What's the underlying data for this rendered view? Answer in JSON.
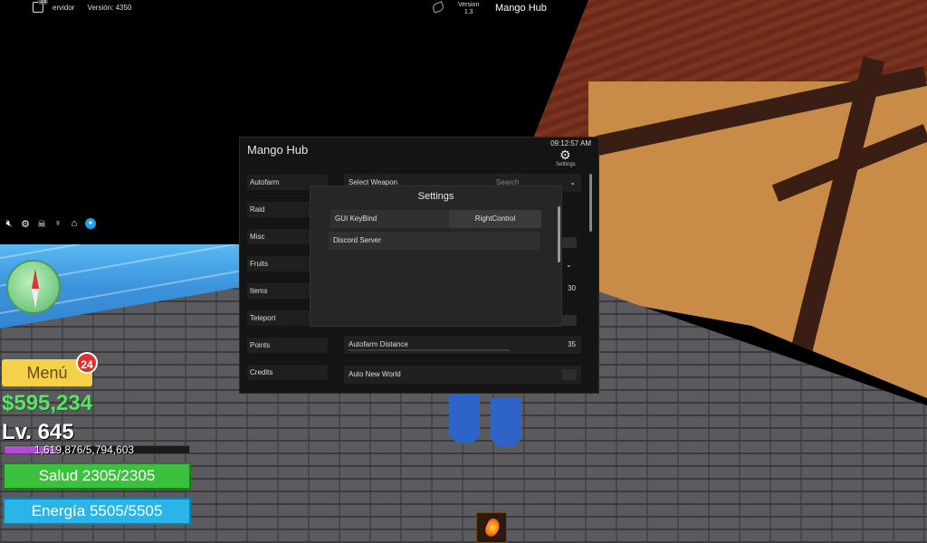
{
  "topbar": {
    "servers_label": "ervidor",
    "server_badge": "13",
    "version_label": "Versión: 4350",
    "hub_version_label": "Version",
    "hub_version_num": "1.3",
    "title": "Mango Hub"
  },
  "quick_icons": [
    "mute-icon",
    "gear-icon",
    "skull-icon",
    "microphone-icon",
    "home-icon",
    "twitter-icon"
  ],
  "hud": {
    "menu_label": "Menú",
    "menu_badge": "24",
    "money": "$595,234",
    "level": "Lv. 645",
    "xp_text": "1,619,876/5,794,603",
    "xp_fraction": 0.2796,
    "health_text": "Salud 2305/2305",
    "energy_text": "Energía 5505/5505"
  },
  "hub": {
    "title": "Mango Hub",
    "time": "09:12:57 AM",
    "settings_label": "Settings",
    "sidebar": [
      "Autofarm",
      "Raid",
      "Misc",
      "Fruits",
      "Items",
      "Teleport",
      "Points",
      "Credits"
    ],
    "select_weapon": {
      "label": "Select Weapon",
      "placeholder": "Search"
    },
    "hidden_value": "30",
    "autofarm_distance": {
      "label": "Autofarm Distance",
      "value": "35"
    },
    "auto_new_world": {
      "label": "Auto New World"
    }
  },
  "settings": {
    "title": "Settings",
    "keybind_label": "GUI KeyBind",
    "keybind_value": "RightControl",
    "discord_label": "Discord Server"
  },
  "colors": {
    "hub_bg": "#141414",
    "settings_bg": "#262626",
    "money": "#5ee06a",
    "health": "#3ac23c",
    "energy": "#2ab4e8",
    "menu": "#f3d24a",
    "xp": "#b44ad8"
  }
}
